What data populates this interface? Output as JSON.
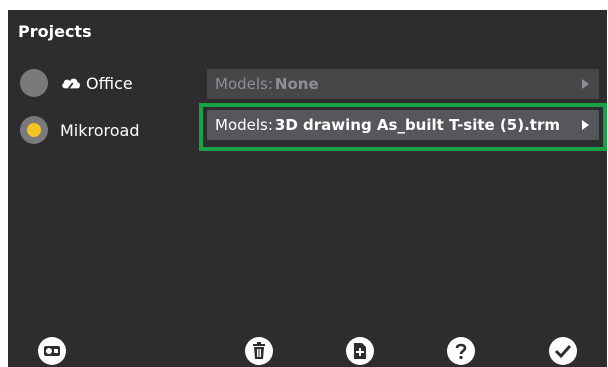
{
  "header": {
    "title": "Projects"
  },
  "projects": [
    {
      "name": "Office",
      "selected": false,
      "cloud": true,
      "icon": "cloud-icon"
    },
    {
      "name": "Mikroroad",
      "selected": true,
      "cloud": false
    }
  ],
  "models": [
    {
      "prefix": "Models:",
      "value": "None",
      "state": "disabled"
    },
    {
      "prefix": "Models:",
      "value": "3D drawing As_built T-site (5).trm",
      "state": "active",
      "highlighted": true
    }
  ],
  "toolbar": {
    "buttons": [
      {
        "icon": "projector-icon"
      },
      {
        "icon": "delete-icon"
      },
      {
        "icon": "new-file-icon"
      },
      {
        "icon": "help-icon"
      },
      {
        "icon": "confirm-check-icon"
      }
    ]
  },
  "colors": {
    "background": "#2d2d2f",
    "selected_radio": "#f4c623",
    "highlight": "#17a243"
  }
}
